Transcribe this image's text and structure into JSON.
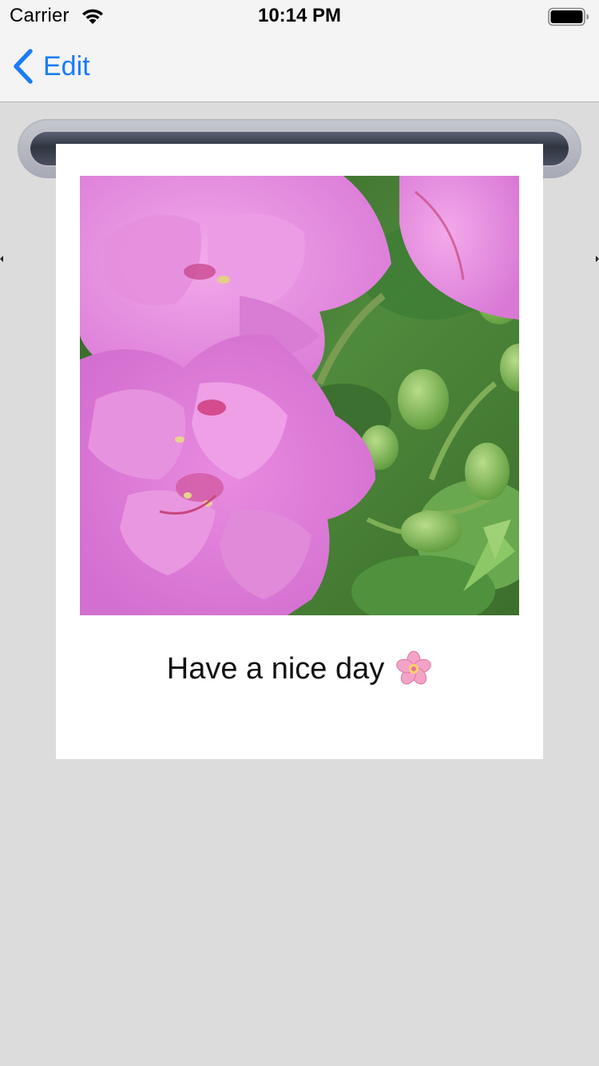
{
  "status_bar": {
    "carrier": "Carrier",
    "time": "10:14 PM",
    "wifi_icon": "wifi-icon",
    "battery_icon": "battery-icon"
  },
  "nav": {
    "back_label": "Edit",
    "back_icon": "chevron-left-icon",
    "accent_color": "#1a7cf5"
  },
  "card": {
    "photo": "pink geranium flowers with green buds",
    "caption": "Have a nice day",
    "caption_emoji_icon": "cherry-blossom-icon"
  },
  "colors": {
    "background": "#dcdcdc",
    "bar_background": "#f4f4f4",
    "card": "#ffffff"
  }
}
